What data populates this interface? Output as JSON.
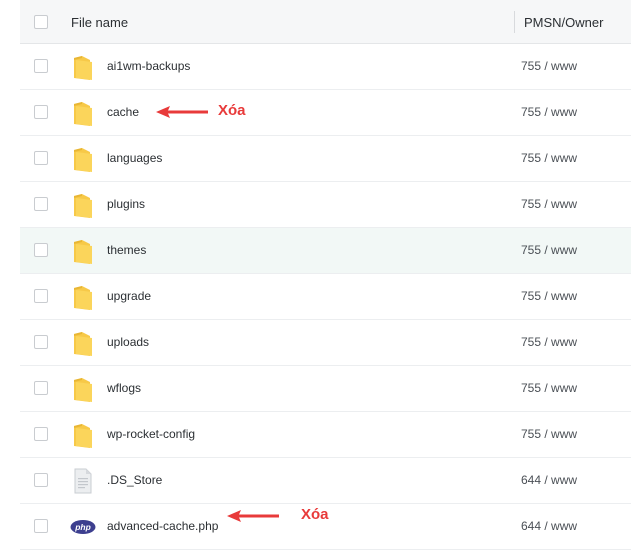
{
  "header": {
    "file_name_label": "File name",
    "perm_owner_label": "PMSN/Owner"
  },
  "rows": [
    {
      "name": "ai1wm-backups",
      "perm": "755 / www",
      "icon": "folder-icon"
    },
    {
      "name": "cache",
      "perm": "755 / www",
      "icon": "folder-icon"
    },
    {
      "name": "languages",
      "perm": "755 / www",
      "icon": "folder-icon"
    },
    {
      "name": "plugins",
      "perm": "755 / www",
      "icon": "folder-icon"
    },
    {
      "name": "themes",
      "perm": "755 / www",
      "icon": "folder-icon"
    },
    {
      "name": "upgrade",
      "perm": "755 / www",
      "icon": "folder-icon"
    },
    {
      "name": "uploads",
      "perm": "755 / www",
      "icon": "folder-icon"
    },
    {
      "name": "wflogs",
      "perm": "755 / www",
      "icon": "folder-icon"
    },
    {
      "name": "wp-rocket-config",
      "perm": "755 / www",
      "icon": "folder-icon"
    },
    {
      "name": ".DS_Store",
      "perm": "644 / www",
      "icon": "file-icon"
    },
    {
      "name": "advanced-cache.php",
      "perm": "644 / www",
      "icon": "php-file-icon"
    }
  ],
  "annotations": {
    "cache_label": "Xóa",
    "advanced_cache_label": "Xóa",
    "color": "#e83a3a"
  },
  "colors": {
    "folder": "#f7c948",
    "highlight_row": "#f2f8f6",
    "php_badge": "#3d3f8f"
  },
  "php_icon_text": "php"
}
